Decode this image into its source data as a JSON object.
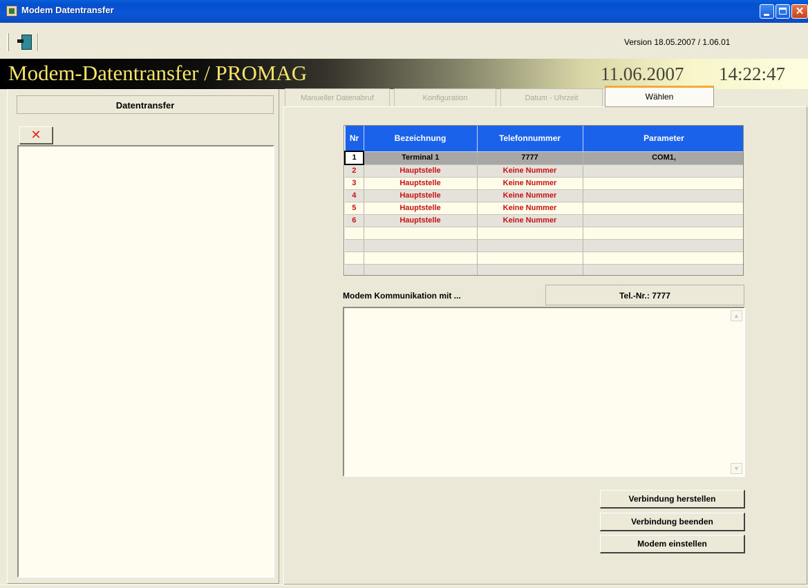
{
  "window": {
    "title": "Modem Datentransfer"
  },
  "toolbar": {
    "exit_icon": "exit-door-icon",
    "version": "Version 18.05.2007 / 1.06.01"
  },
  "header": {
    "app_title": "Modem-Datentransfer / PROMAG",
    "date": "11.06.2007",
    "time": "14:22:47"
  },
  "left_panel": {
    "title": "Datentransfer",
    "delete_glyph": "✕",
    "items": []
  },
  "tabs": [
    {
      "label": "Manueller Datenabruf",
      "active": false
    },
    {
      "label": "Konfiguration",
      "active": false
    },
    {
      "label": "Datum - Uhrzeit",
      "active": false
    },
    {
      "label": "Wählen",
      "active": true
    }
  ],
  "table": {
    "columns": [
      "Nr",
      "Bezeichnung",
      "Telefonnummer",
      "Parameter"
    ],
    "rows": [
      {
        "nr": "1",
        "name": "Terminal 1",
        "phone": "7777",
        "param": "COM1,",
        "selected": true
      },
      {
        "nr": "2",
        "name": "Hauptstelle",
        "phone": "Keine Nummer",
        "param": ""
      },
      {
        "nr": "3",
        "name": "Hauptstelle",
        "phone": "Keine Nummer",
        "param": ""
      },
      {
        "nr": "4",
        "name": "Hauptstelle",
        "phone": "Keine Nummer",
        "param": ""
      },
      {
        "nr": "5",
        "name": "Hauptstelle",
        "phone": "Keine Nummer",
        "param": ""
      },
      {
        "nr": "6",
        "name": "Hauptstelle",
        "phone": "Keine Nummer",
        "param": ""
      }
    ]
  },
  "modem": {
    "label": "Modem Kommunikation mit ...",
    "phone_display": "Tel.-Nr.: 7777",
    "log_text": ""
  },
  "buttons": {
    "connect": "Verbindung herstellen",
    "disconnect": "Verbindung beenden",
    "setup": "Modem einstellen"
  },
  "colors": {
    "titlebar": "#0a56d8",
    "table_header": "#1a62ea",
    "error_text": "#c61111",
    "active_tab_accent": "#f4a83a",
    "title_text": "#f5e36a"
  }
}
